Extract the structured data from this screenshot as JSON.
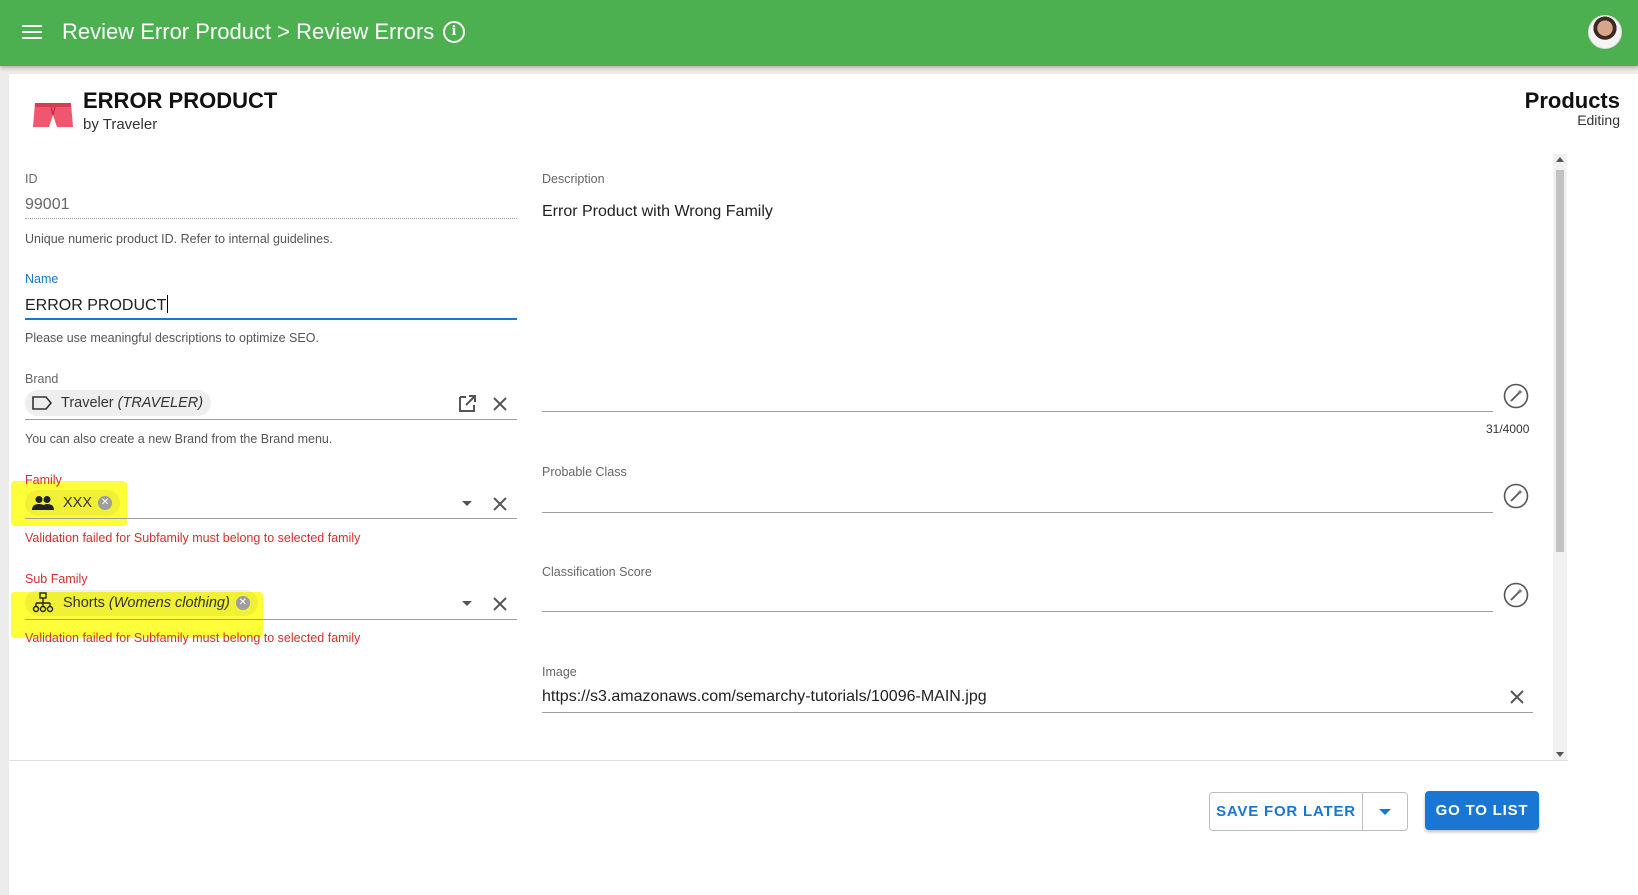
{
  "appbar": {
    "title": "Review Error Product > Review Errors",
    "brand_color": "#4caf50"
  },
  "header": {
    "title": "ERROR PRODUCT",
    "subtitle": "by Traveler",
    "entity": "Products",
    "mode": "Editing"
  },
  "form": {
    "id": {
      "label": "ID",
      "value": "99001",
      "hint": "Unique numeric product ID. Refer to internal guidelines."
    },
    "name": {
      "label": "Name",
      "value": "ERROR PRODUCT",
      "hint": "Please use meaningful descriptions to optimize SEO."
    },
    "brand": {
      "label": "Brand",
      "chip_name": "Traveler",
      "chip_code": "(TRAVELER)",
      "hint": "You can also create a new Brand from the Brand menu."
    },
    "family": {
      "label": "Family",
      "chip_name": "XXX",
      "error": "Validation failed for Subfamily must belong to selected family"
    },
    "subfamily": {
      "label": "Sub Family",
      "chip_name": "Shorts",
      "chip_code": "(Womens clothing)",
      "error": "Validation failed for Subfamily must belong to selected family"
    },
    "description": {
      "label": "Description",
      "value": "Error Product with Wrong Family",
      "counter": "31/4000"
    },
    "probable_class": {
      "label": "Probable Class",
      "value": ""
    },
    "classification_score": {
      "label": "Classification Score",
      "value": ""
    },
    "image": {
      "label": "Image",
      "value": "https://s3.amazonaws.com/semarchy-tutorials/10096-MAIN.jpg"
    }
  },
  "footer": {
    "save_label": "SAVE FOR LATER",
    "go_label": "GO TO LIST"
  },
  "colors": {
    "accent": "#1976d2",
    "error": "#d32f2f",
    "highlight": "#ffff2e"
  }
}
